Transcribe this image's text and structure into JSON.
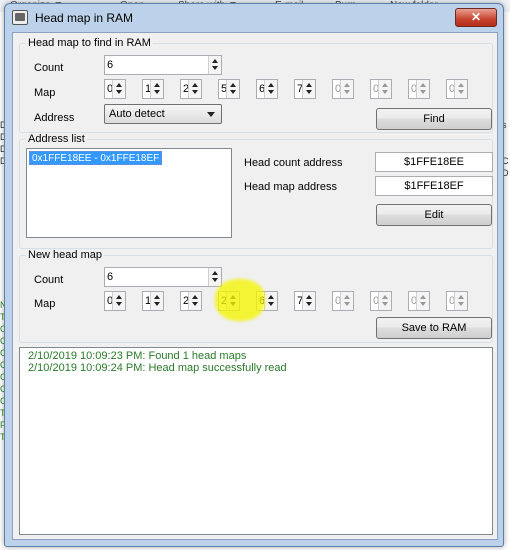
{
  "background": {
    "toolbar_items": [
      "Organize ▼",
      "Open",
      "Share with ▼",
      "E-mail",
      "Burn",
      "New folder"
    ],
    "left_edge_chars": [
      "D",
      "D",
      "D",
      "D",
      "N",
      "T",
      "O",
      "C",
      "C",
      "C",
      "C",
      "C",
      "C",
      "T",
      "F",
      "T"
    ],
    "right_edge_chars": [
      "s",
      "C",
      "D"
    ]
  },
  "window": {
    "title": "Head map in RAM",
    "close_label": "✕"
  },
  "find_group": {
    "legend": "Head map to find in RAM",
    "count_label": "Count",
    "count_value": "6",
    "map_label": "Map",
    "map_values": [
      "0",
      "1",
      "2",
      "5",
      "6",
      "7",
      "0",
      "0",
      "0",
      "0"
    ],
    "address_label": "Address",
    "address_selected": "Auto detect",
    "find_button": "Find"
  },
  "address_group": {
    "legend": "Address list",
    "list_items": [
      "0x1FFE18EE - 0x1FFE18EF"
    ],
    "head_count_label": "Head count address",
    "head_count_value": "$1FFE18EE",
    "head_map_label": "Head map address",
    "head_map_value": "$1FFE18EF",
    "edit_button": "Edit"
  },
  "new_group": {
    "legend": "New head map",
    "count_label": "Count",
    "count_value": "6",
    "map_label": "Map",
    "map_values": [
      "0",
      "1",
      "2",
      "2",
      "6",
      "7",
      "0",
      "0",
      "0",
      "0"
    ],
    "save_button": "Save to RAM"
  },
  "log": [
    "2/10/2019 10:09:23 PM: Found 1 head maps",
    "2/10/2019 10:09:24 PM: Head map successfully read"
  ],
  "colors": {
    "log_text": "#2a7a2a",
    "selection": "#3399ff",
    "highlight": "#f5f500"
  }
}
